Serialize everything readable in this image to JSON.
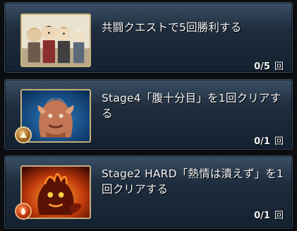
{
  "quests": [
    {
      "title": "共闘クエストで5回勝利する",
      "progress": "0/5",
      "unit": "回",
      "thumbnail_icon": "party-portrait-icon"
    },
    {
      "title": "Stage4「腹十分目」を1回クリアする",
      "progress": "0/1",
      "unit": "回",
      "thumbnail_icon": "boss-portrait-icon",
      "element_icon": "earth-element-icon"
    },
    {
      "title": "Stage2 HARD「熱情は潰えず」を1回クリアする",
      "progress": "0/1",
      "unit": "回",
      "thumbnail_icon": "fire-boss-portrait-icon",
      "element_icon": "fire-element-icon"
    }
  ],
  "colors": {
    "card_top": "#2a3b4f",
    "card_bottom": "#132131",
    "thumb_border": "#c7b07a",
    "text": "#f4f4f4"
  }
}
